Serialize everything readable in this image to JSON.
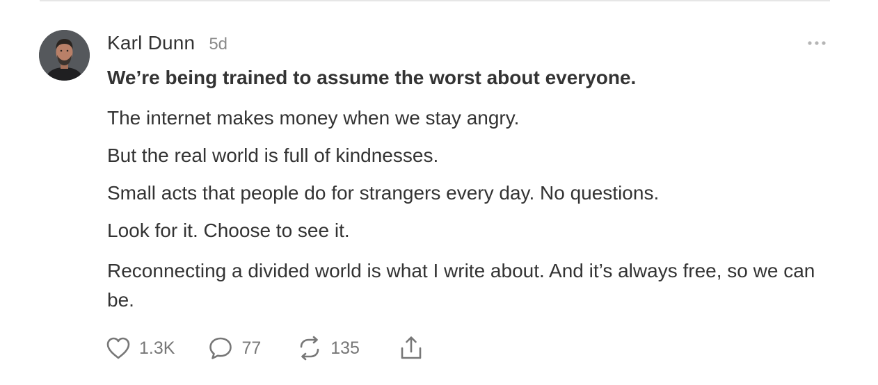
{
  "post": {
    "author": {
      "name": "Karl Dunn",
      "avatar_icon": "avatar-photo"
    },
    "time_ago": "5d",
    "headline": "We’re being trained to assume the worst about everyone.",
    "paragraphs": [
      "The internet makes money when we stay angry.",
      "But the real world is full of kindnesses.",
      "Small acts that people do for strangers every day. No questions.",
      "Look for it. Choose to see it.",
      "Reconnecting a divided world is what I write about. And it’s always free, so we can be."
    ],
    "actions": {
      "likes": "1.3K",
      "comments": "77",
      "restacks": "135"
    }
  },
  "icons": {
    "more": "more-horizontal-icon",
    "like": "heart-icon",
    "comment": "comment-bubble-icon",
    "restack": "restack-arrows-icon",
    "share": "share-upload-icon"
  },
  "colors": {
    "text": "#333333",
    "muted": "#777777",
    "divider": "#e6e6e6"
  }
}
